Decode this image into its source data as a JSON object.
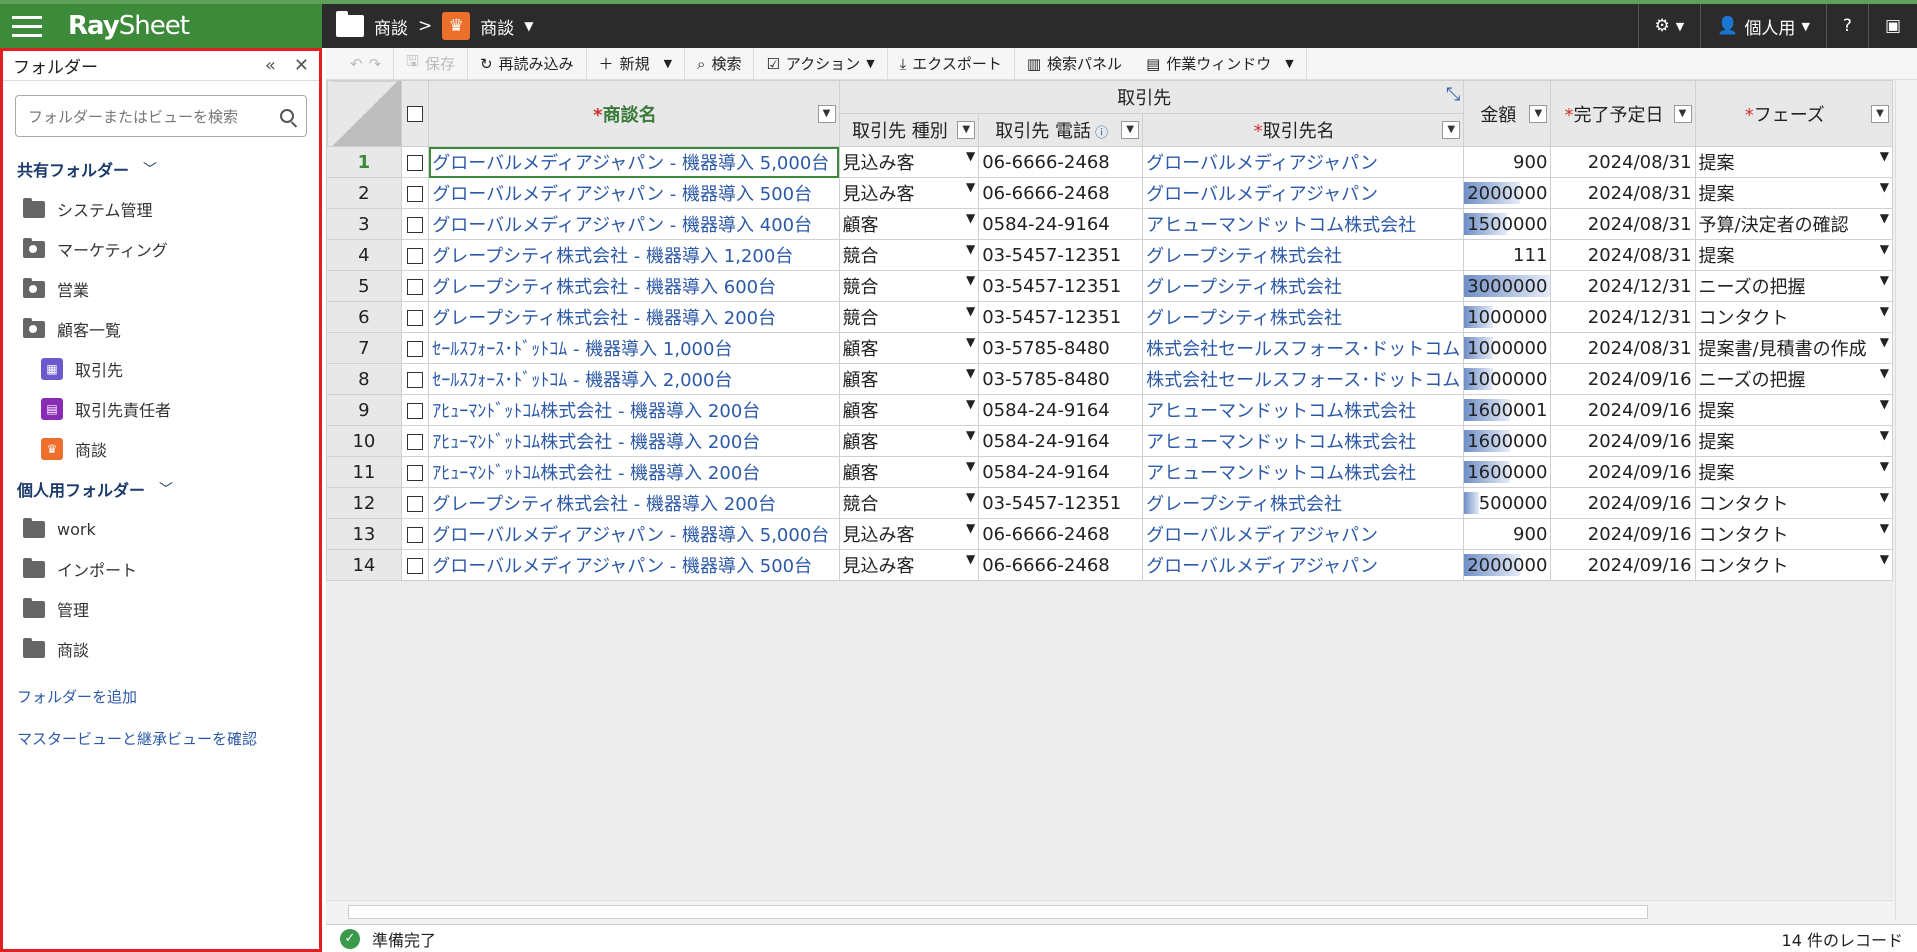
{
  "app": {
    "logo_ray": "Ray",
    "logo_sheet": "Sheet"
  },
  "breadcrumb": {
    "root": "商談",
    "sep": ">",
    "current": "商談"
  },
  "topbar": {
    "user": "個人用",
    "help": "?"
  },
  "sidebar": {
    "title": "フォルダー",
    "search_placeholder": "フォルダーまたはビューを検索",
    "shared_label": "共有フォルダー",
    "shared_items": [
      {
        "label": "システム管理"
      },
      {
        "label": "マーケティング"
      },
      {
        "label": "営業"
      },
      {
        "label": "顧客一覧"
      }
    ],
    "sub_items": [
      {
        "label": "取引先",
        "color": "#6a5acd"
      },
      {
        "label": "取引先責任者",
        "color": "#8a2bb5"
      },
      {
        "label": "商談",
        "color": "#ec6f2b"
      }
    ],
    "personal_label": "個人用フォルダー",
    "personal_items": [
      {
        "label": "work"
      },
      {
        "label": "インポート"
      },
      {
        "label": "管理"
      },
      {
        "label": "商談"
      }
    ],
    "add_folder": "フォルダーを追加",
    "master_view": "マスタービューと継承ビューを確認"
  },
  "toolbar": {
    "save": "保存",
    "reload": "再読み込み",
    "new": "新規",
    "search": "検索",
    "action": "アクション",
    "export": "エクスポート",
    "search_panel": "検索パネル",
    "work_window": "作業ウィンドウ"
  },
  "grid": {
    "group_header": "取引先",
    "col_name": "商談名",
    "col_type": "取引先 種別",
    "col_phone": "取引先 電話",
    "col_account": "取引先名",
    "col_amount": "金額",
    "col_date": "完了予定日",
    "col_phase": "フェーズ",
    "rows": [
      {
        "n": "1",
        "name": "グローバルメディアジャパン - 機器導入 5,000台",
        "type": "見込み客",
        "phone": "06-6666-2468",
        "account": "グローバルメディアジャパン",
        "amount": "900",
        "bar": 0,
        "date": "2024/08/31",
        "phase": "提案"
      },
      {
        "n": "2",
        "name": "グローバルメディアジャパン - 機器導入 500台",
        "type": "見込み客",
        "phone": "06-6666-2468",
        "account": "グローバルメディアジャパン",
        "amount": "2000000",
        "bar": 0.65,
        "date": "2024/08/31",
        "phase": "提案"
      },
      {
        "n": "3",
        "name": "グローバルメディアジャパン - 機器導入 400台",
        "type": "顧客",
        "phone": "0584-24-9164",
        "account": "アヒューマンドットコム株式会社",
        "amount": "1500000",
        "bar": 0.5,
        "date": "2024/08/31",
        "phase": "予算/決定者の確認"
      },
      {
        "n": "4",
        "name": "グレープシティ株式会社 - 機器導入 1,200台",
        "type": "競合",
        "phone": "03-5457-12351",
        "account": "グレープシティ株式会社",
        "amount": "111",
        "bar": 0,
        "date": "2024/08/31",
        "phase": "提案"
      },
      {
        "n": "5",
        "name": "グレープシティ株式会社 - 機器導入 600台",
        "type": "競合",
        "phone": "03-5457-12351",
        "account": "グレープシティ株式会社",
        "amount": "3000000",
        "bar": 1,
        "date": "2024/12/31",
        "phase": "ニーズの把握"
      },
      {
        "n": "6",
        "name": "グレープシティ株式会社 - 機器導入 200台",
        "type": "競合",
        "phone": "03-5457-12351",
        "account": "グレープシティ株式会社",
        "amount": "1000000",
        "bar": 0.33,
        "date": "2024/12/31",
        "phase": "コンタクト"
      },
      {
        "n": "7",
        "name": "ｾｰﾙｽﾌｫｰｽ･ﾄﾞｯﾄｺﾑ - 機器導入 1,000台",
        "type": "顧客",
        "phone": "03-5785-8480",
        "account": "株式会社セールスフォース･ドットコム",
        "amount": "1000000",
        "bar": 0.33,
        "date": "2024/08/31",
        "phase": "提案書/見積書の作成"
      },
      {
        "n": "8",
        "name": "ｾｰﾙｽﾌｫｰｽ･ﾄﾞｯﾄｺﾑ - 機器導入 2,000台",
        "type": "顧客",
        "phone": "03-5785-8480",
        "account": "株式会社セールスフォース･ドットコム",
        "amount": "1000000",
        "bar": 0.33,
        "date": "2024/09/16",
        "phase": "ニーズの把握"
      },
      {
        "n": "9",
        "name": "ｱﾋｭｰﾏﾝﾄﾞｯﾄｺﾑ株式会社 - 機器導入 200台",
        "type": "顧客",
        "phone": "0584-24-9164",
        "account": "アヒューマンドットコム株式会社",
        "amount": "1600001",
        "bar": 0.53,
        "date": "2024/09/16",
        "phase": "提案"
      },
      {
        "n": "10",
        "name": "ｱﾋｭｰﾏﾝﾄﾞｯﾄｺﾑ株式会社 - 機器導入 200台",
        "type": "顧客",
        "phone": "0584-24-9164",
        "account": "アヒューマンドットコム株式会社",
        "amount": "1600000",
        "bar": 0.53,
        "date": "2024/09/16",
        "phase": "提案"
      },
      {
        "n": "11",
        "name": "ｱﾋｭｰﾏﾝﾄﾞｯﾄｺﾑ株式会社 - 機器導入 200台",
        "type": "顧客",
        "phone": "0584-24-9164",
        "account": "アヒューマンドットコム株式会社",
        "amount": "1600000",
        "bar": 0.53,
        "date": "2024/09/16",
        "phase": "提案"
      },
      {
        "n": "12",
        "name": "グレープシティ株式会社 - 機器導入 200台",
        "type": "競合",
        "phone": "03-5457-12351",
        "account": "グレープシティ株式会社",
        "amount": "500000",
        "bar": 0.17,
        "date": "2024/09/16",
        "phase": "コンタクト"
      },
      {
        "n": "13",
        "name": "グローバルメディアジャパン - 機器導入 5,000台",
        "type": "見込み客",
        "phone": "06-6666-2468",
        "account": "グローバルメディアジャパン",
        "amount": "900",
        "bar": 0,
        "date": "2024/09/16",
        "phase": "コンタクト"
      },
      {
        "n": "14",
        "name": "グローバルメディアジャパン - 機器導入 500台",
        "type": "見込み客",
        "phone": "06-6666-2468",
        "account": "グローバルメディアジャパン",
        "amount": "2000000",
        "bar": 0.65,
        "date": "2024/09/16",
        "phase": "コンタクト"
      }
    ]
  },
  "status": {
    "ready": "準備完了",
    "count": "14 件のレコード"
  }
}
